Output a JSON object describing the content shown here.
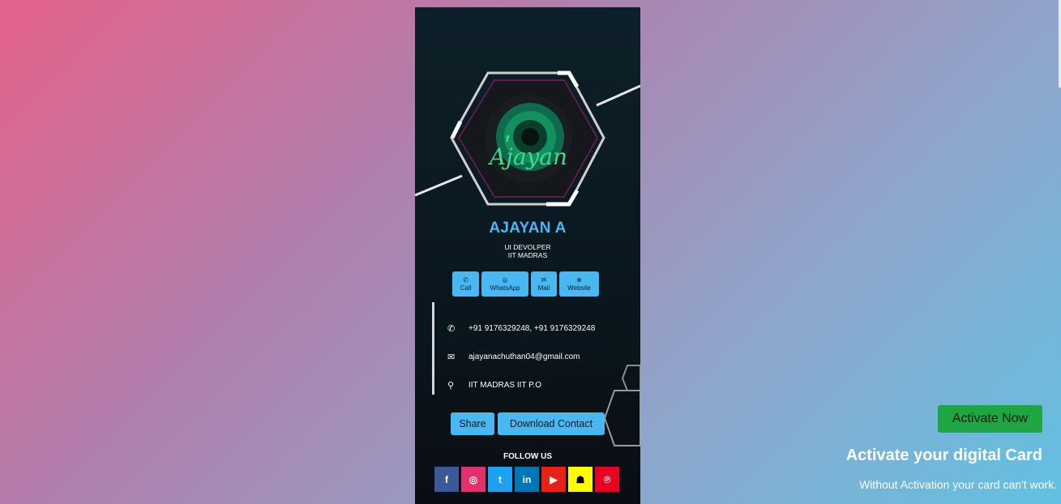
{
  "profile": {
    "name": "AJAYAN A",
    "role": "UI DEVOLPER",
    "organization": "IIT MADRAS",
    "logo_text": "Ajayan"
  },
  "actions": {
    "call": "Call",
    "whatsapp": "WhatsApp",
    "mail": "Mail",
    "website": "Website"
  },
  "contact": {
    "phone": "+91 9176329248, +91 9176329248",
    "email": "ajayanachuthan04@gmail.com",
    "address": "IIT MADRAS IIT P.O"
  },
  "buttons": {
    "share": "Share",
    "download": "Download Contact"
  },
  "follow": {
    "label": "FOLLOW US",
    "networks": [
      "facebook",
      "instagram",
      "twitter",
      "linkedin",
      "youtube",
      "snapchat",
      "pinterest"
    ]
  },
  "activation": {
    "button": "Activate Now",
    "title": "Activate your digital Card",
    "subtitle": "Without Activation your card can't work."
  },
  "colors": {
    "accent": "#48b8f2",
    "name": "#4db5f0",
    "activate": "#1fa542",
    "facebook": "#3b5998",
    "instagram": "#e1306c",
    "twitter": "#1da1f2",
    "linkedin": "#0077b5",
    "youtube": "#e62117",
    "snapchat": "#fffc00",
    "pinterest": "#e60023"
  }
}
